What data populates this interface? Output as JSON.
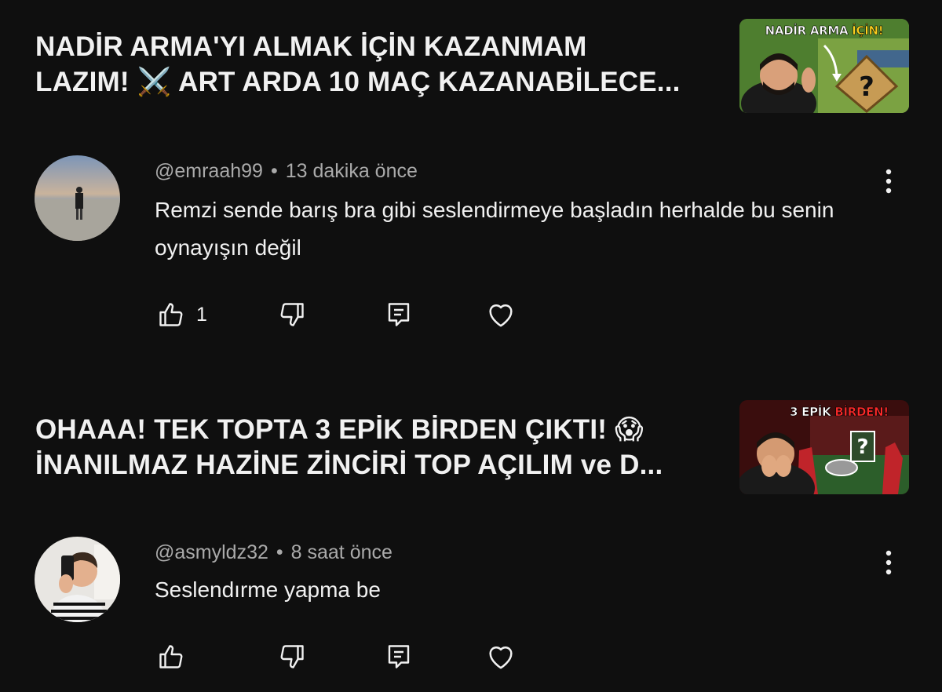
{
  "items": [
    {
      "video_title": "NADİR ARMA'YI ALMAK İÇİN KAZANMAM\nLAZIM! ⚔️ ART ARDA 10 MAÇ KAZANABİLECE...",
      "thumbnail": {
        "caption_white": "NADİR ARMA",
        "caption_yellow": "İÇİN!"
      },
      "comment": {
        "author": "@emraah99",
        "time": "13 dakika önce",
        "text": "Remzi sende barış bra gibi seslendirmeye başladın herhalde bu senin oynayışın değil",
        "like_count": "1"
      }
    },
    {
      "video_title": "OHAAA! TEK TOPTA 3 EPİK BİRDEN ÇIKTI! 😱\nİNANILMAZ HAZİNE ZİNCİRİ TOP AÇILIM ve D...",
      "thumbnail": {
        "caption_white": "3 EPİK",
        "caption_red": "BİRDEN!"
      },
      "comment": {
        "author": "@asmyldz32",
        "time": "8 saat önce",
        "text": "Seslendırme yapma be",
        "like_count": ""
      }
    }
  ],
  "icons": [
    "thumb-up-icon",
    "thumb-down-icon",
    "reply-icon",
    "heart-icon",
    "more-vert-icon"
  ],
  "colors": {
    "background": "#0f0f0f",
    "text": "#f1f1f1",
    "secondary_text": "#aaaaaa"
  }
}
